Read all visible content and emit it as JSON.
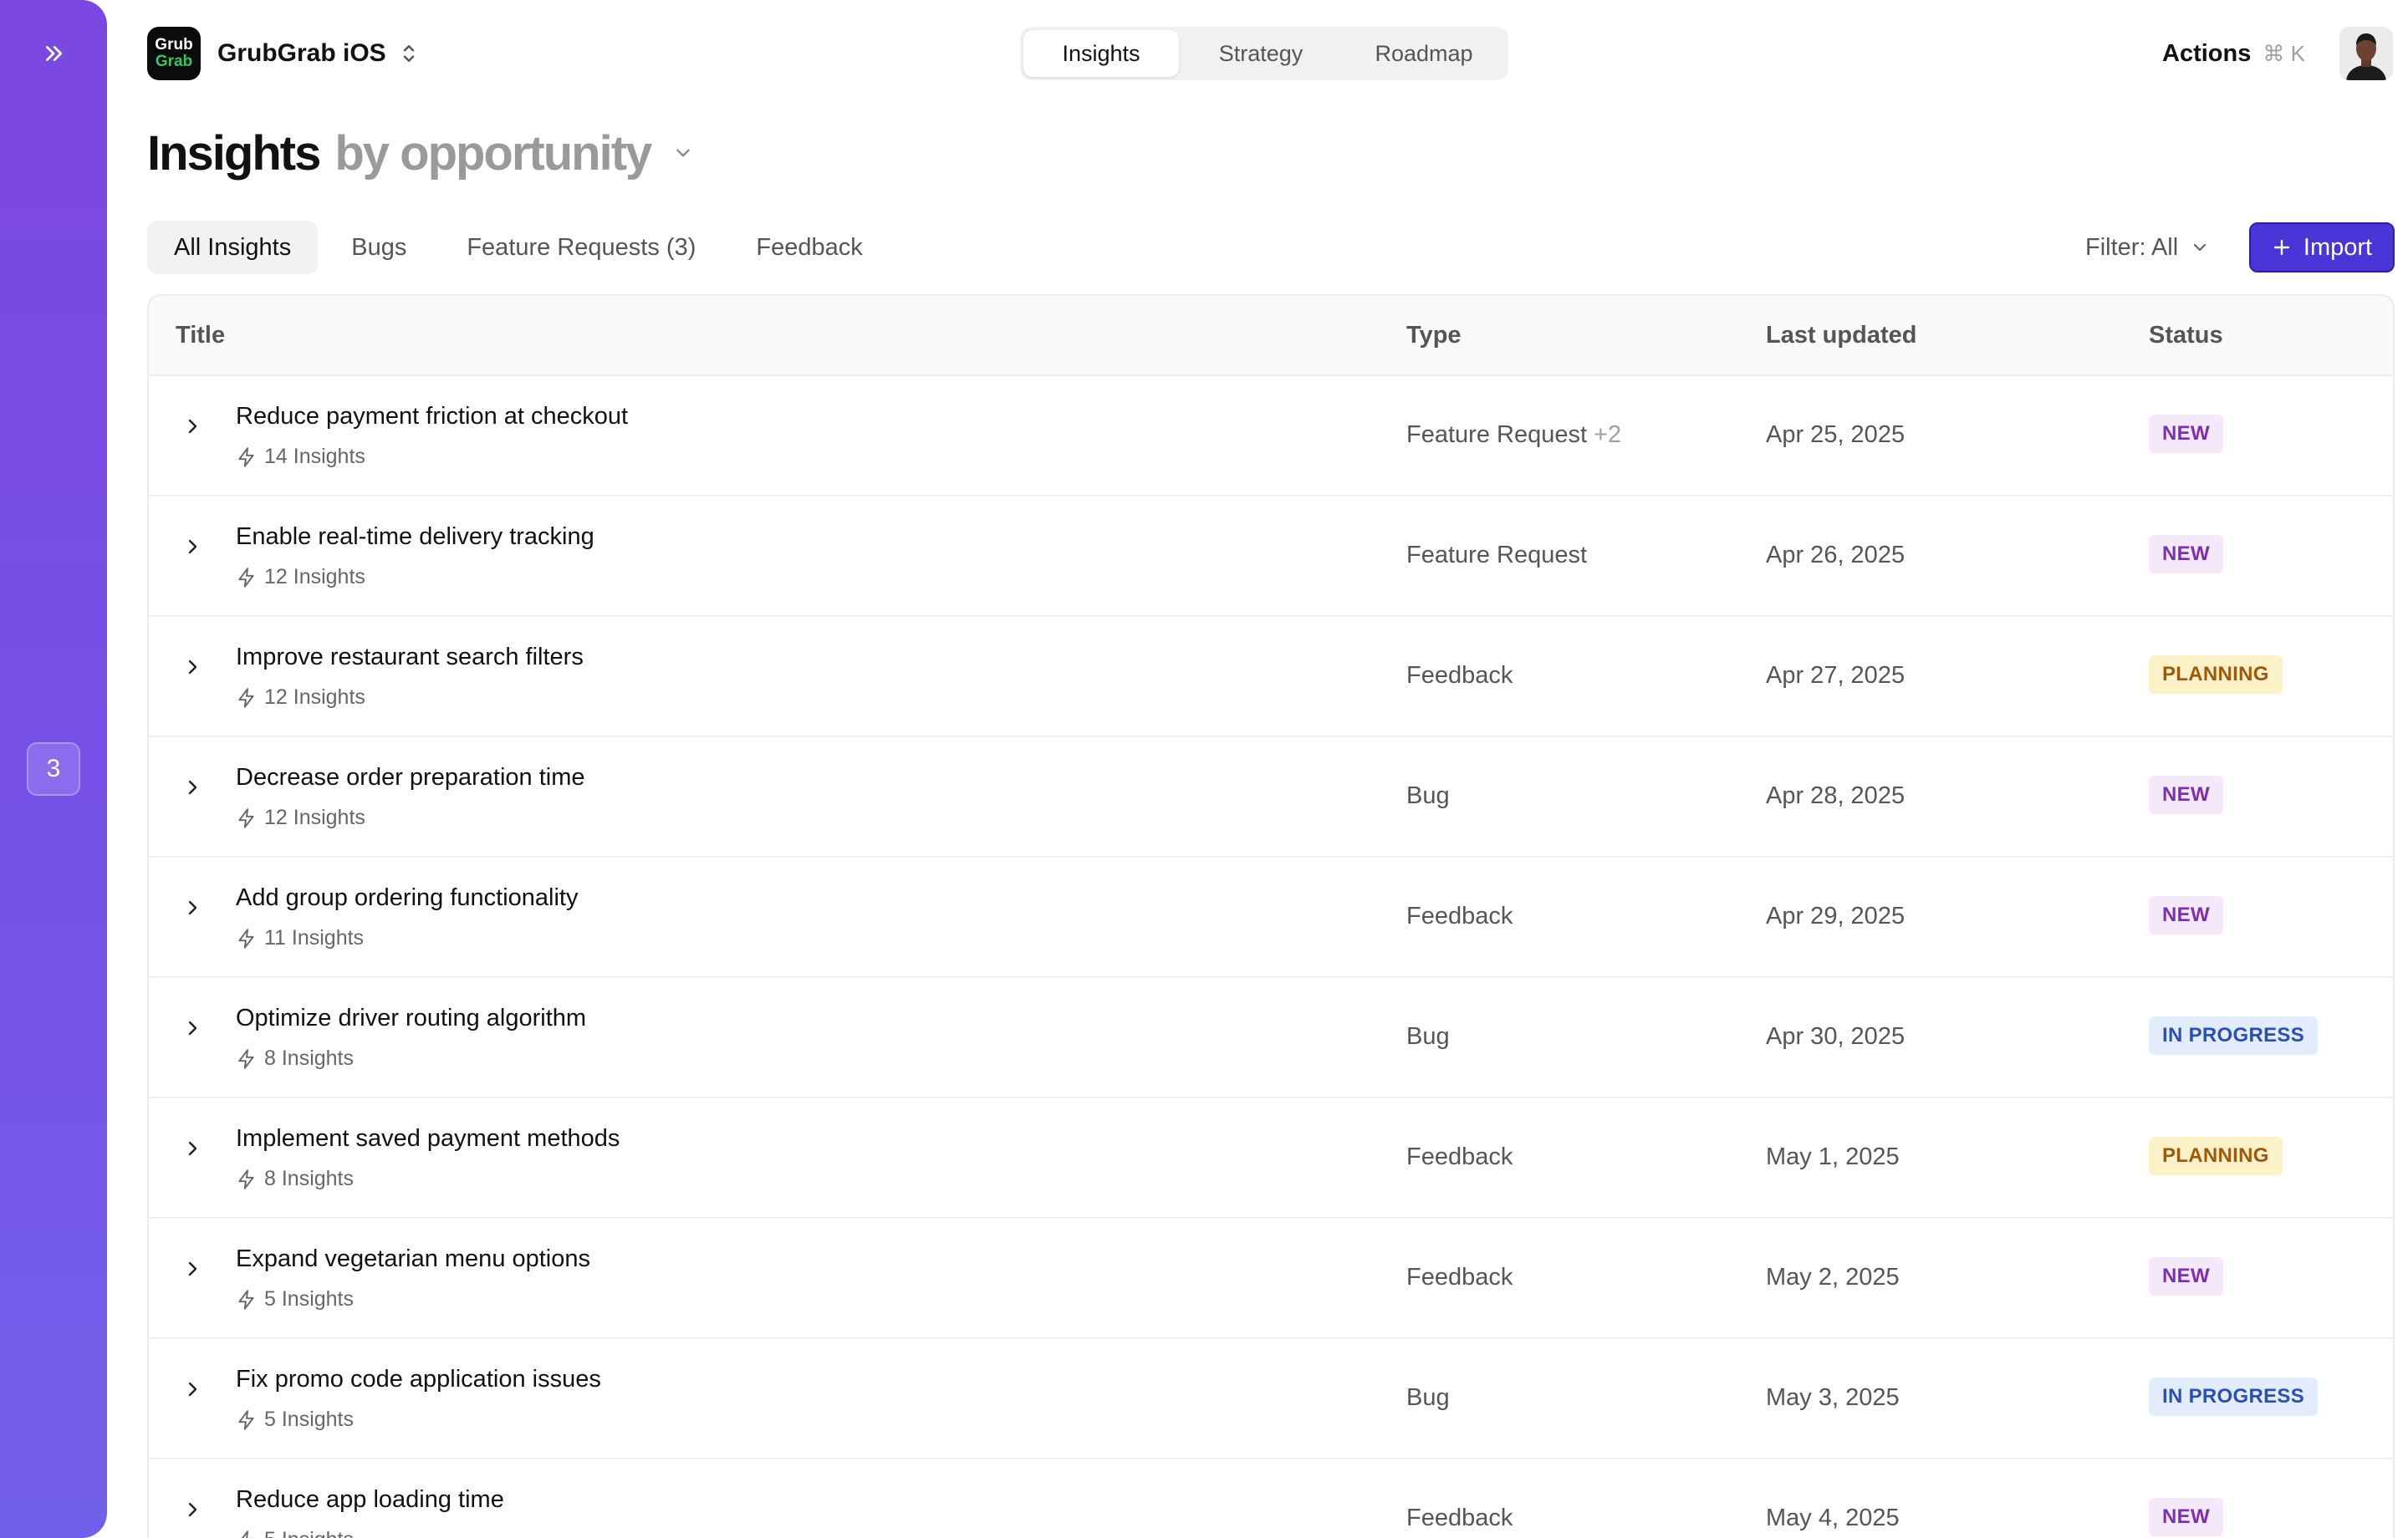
{
  "rail": {
    "badge_count": "3"
  },
  "app": {
    "logo_line1": "Grub",
    "logo_line2": "Grab",
    "name": "GrubGrab iOS"
  },
  "nav": {
    "tabs": [
      "Insights",
      "Strategy",
      "Roadmap"
    ],
    "active": "Insights"
  },
  "topbar": {
    "actions_label": "Actions",
    "shortcut": "⌘ K"
  },
  "page": {
    "title": "Insights",
    "grouping": "by opportunity"
  },
  "subtabs": [
    "All Insights",
    "Bugs",
    "Feature Requests (3)",
    "Feedback"
  ],
  "toolbar": {
    "filter_label": "Filter: All",
    "import_label": "Import"
  },
  "table": {
    "columns": [
      "Title",
      "Type",
      "Last updated",
      "Status"
    ],
    "rows": [
      {
        "title": "Reduce payment friction at checkout",
        "insights": "14 Insights",
        "type": "Feature Request",
        "type_extra": "+2",
        "date": "Apr 25, 2025",
        "status": "NEW"
      },
      {
        "title": "Enable real-time delivery tracking",
        "insights": "12 Insights",
        "type": "Feature Request",
        "type_extra": "",
        "date": "Apr 26, 2025",
        "status": "NEW"
      },
      {
        "title": "Improve restaurant search filters",
        "insights": "12 Insights",
        "type": "Feedback",
        "type_extra": "",
        "date": "Apr 27, 2025",
        "status": "PLANNING"
      },
      {
        "title": "Decrease order preparation time",
        "insights": "12 Insights",
        "type": "Bug",
        "type_extra": "",
        "date": "Apr 28, 2025",
        "status": "NEW"
      },
      {
        "title": "Add group ordering functionality",
        "insights": "11 Insights",
        "type": "Feedback",
        "type_extra": "",
        "date": "Apr 29, 2025",
        "status": "NEW"
      },
      {
        "title": "Optimize driver routing algorithm",
        "insights": "8 Insights",
        "type": "Bug",
        "type_extra": "",
        "date": "Apr 30, 2025",
        "status": "IN PROGRESS"
      },
      {
        "title": "Implement saved payment methods",
        "insights": "8 Insights",
        "type": "Feedback",
        "type_extra": "",
        "date": "May 1, 2025",
        "status": "PLANNING"
      },
      {
        "title": "Expand vegetarian menu options",
        "insights": "5 Insights",
        "type": "Feedback",
        "type_extra": "",
        "date": "May 2, 2025",
        "status": "NEW"
      },
      {
        "title": "Fix promo code application issues",
        "insights": "5 Insights",
        "type": "Bug",
        "type_extra": "",
        "date": "May 3, 2025",
        "status": "IN PROGRESS"
      },
      {
        "title": "Reduce app loading time",
        "insights": "5 Insights",
        "type": "Feedback",
        "type_extra": "",
        "date": "May 4, 2025",
        "status": "NEW"
      }
    ]
  },
  "colors": {
    "rail_gradient_top": "#7b47e0",
    "rail_gradient_bottom": "#7360ea",
    "accent": "#4b35d9",
    "status_new": "#7b2fb0",
    "status_planning": "#a0580a",
    "status_in_progress": "#2a4fb5"
  },
  "icons": {
    "rail_expand": "double-chevron-right-icon",
    "app_switcher": "chevron-up-down-icon",
    "grouping_dropdown": "chevron-down-icon",
    "row_expand": "chevron-right-icon",
    "insights_count": "lightning-icon",
    "import": "plus-icon"
  }
}
